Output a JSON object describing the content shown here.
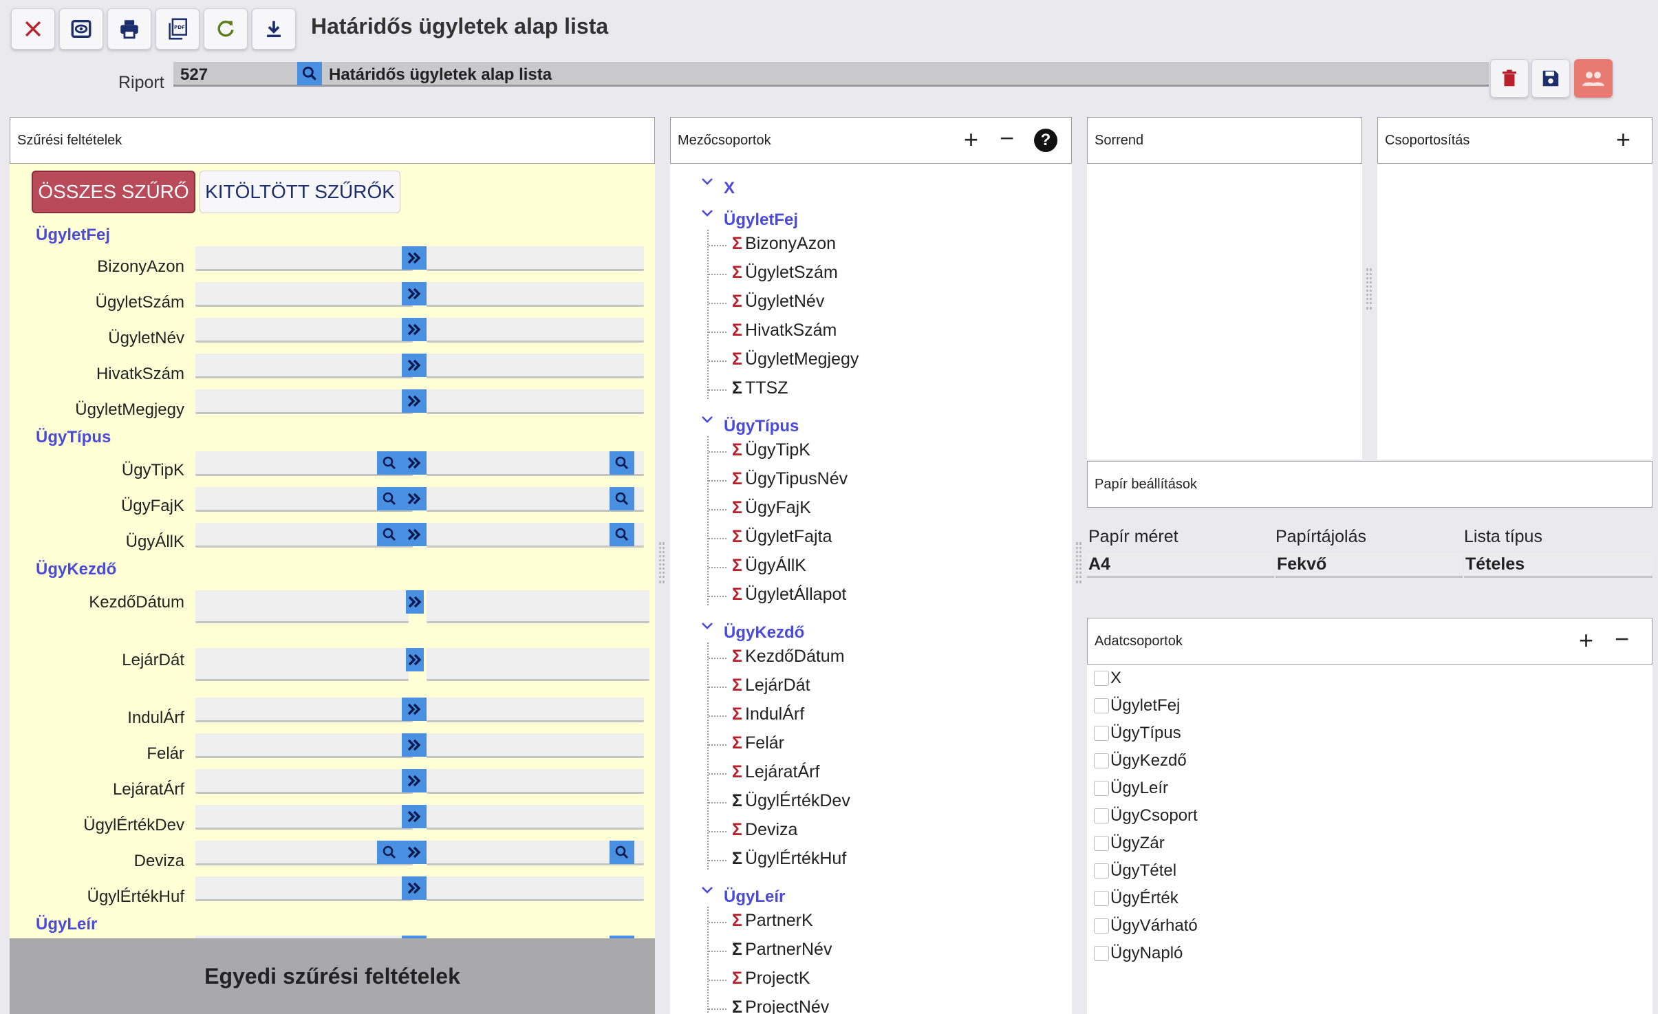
{
  "toolbar": {
    "title": "Határidős ügyletek alap lista",
    "buttons": [
      "close-icon",
      "preview-icon",
      "print-icon",
      "pdf-icon",
      "refresh-icon",
      "download-icon"
    ]
  },
  "riport": {
    "label": "Riport",
    "number": "527",
    "name": "Határidős ügyletek alap lista"
  },
  "colors": {
    "accent": "#4a90e2",
    "danger": "#b94a5a",
    "group": "#4b4bdb",
    "filter_bg": "#ffffd6"
  },
  "filter_panel": {
    "title": "Szűrési feltételek",
    "btn_all": "ÖSSZES SZŰRŐ",
    "btn_filled": "KITÖLTÖTT SZŰRŐK",
    "groups": [
      "ÜgyletFej",
      "ÜgyTípus",
      "ÜgyKezdő",
      "ÜgyLeír"
    ],
    "fields": {
      "bizonyazon": "BizonyAzon",
      "ugyletszam": "ÜgyletSzám",
      "ugyletnev": "ÜgyletNév",
      "hivatkszam": "HivatkSzám",
      "ugyletmegjegy": "ÜgyletMegjegy",
      "ugytipk": "ÜgyTipK",
      "ugyfajk": "ÜgyFajK",
      "ugyallk": "ÜgyÁllK",
      "kezdodatum": "KezdőDátum",
      "lejardat": "LejárDát",
      "indularf": "IndulÁrf",
      "felar": "Felár",
      "lejaratarf": "LejáratÁrf",
      "ugylertekdev": "ÜgylÉrtékDev",
      "deviza": "Deviza",
      "ugylertekhuf": "ÜgylÉrtékHuf"
    },
    "custom_filters": "Egyedi szűrési feltételek"
  },
  "mezocsoportok": {
    "title": "Mezőcsoportok",
    "tree": [
      {
        "group": "X",
        "items": []
      },
      {
        "group": "ÜgyletFej",
        "items": [
          "BizonyAzon",
          "ÜgyletSzám",
          "ÜgyletNév",
          "HivatkSzám",
          "ÜgyletMegjegy",
          "TTSZ"
        ]
      },
      {
        "group": "ÜgyTípus",
        "items": [
          "ÜgyTipK",
          "ÜgyTipusNév",
          "ÜgyFajK",
          "ÜgyletFajta",
          "ÜgyÁllK",
          "ÜgyletÁllapot"
        ]
      },
      {
        "group": "ÜgyKezdő",
        "items": [
          "KezdőDátum",
          "LejárDát",
          "IndulÁrf",
          "Felár",
          "LejáratÁrf",
          "ÜgylÉrtékDev",
          "Deviza",
          "ÜgylÉrtékHuf"
        ]
      },
      {
        "group": "ÜgyLeír",
        "items": [
          "PartnerK",
          "PartnerNév",
          "ProjectK",
          "ProjectNév"
        ]
      }
    ],
    "sigma": "Σ"
  },
  "sorrend": {
    "title": "Sorrend"
  },
  "csoportositas": {
    "title": "Csoportosítás"
  },
  "papir": {
    "title": "Papír beállítások",
    "col_size": "Papír méret",
    "col_orient": "Papírtájolás",
    "col_type": "Lista típus",
    "size": "A4",
    "orient": "Fekvő",
    "type": "Tételes"
  },
  "adatcsoportok": {
    "title": "Adatcsoportok",
    "items": [
      "X",
      "ÜgyletFej",
      "ÜgyTípus",
      "ÜgyKezdő",
      "ÜgyLeír",
      "ÜgyCsoport",
      "ÜgyZár",
      "ÜgyTétel",
      "ÜgyÉrték",
      "ÜgyVárható",
      "ÜgyNapló"
    ]
  }
}
